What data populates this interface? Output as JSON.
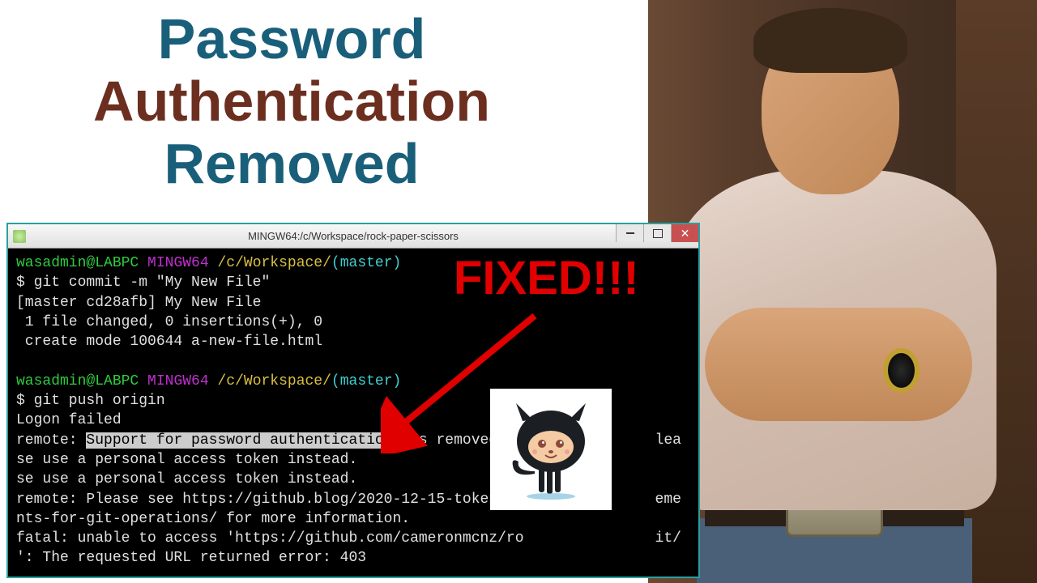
{
  "title": {
    "line1": "Password",
    "line2": "Authentication",
    "line3": "Removed"
  },
  "overlay": {
    "fixed": "FIXED!!!"
  },
  "window": {
    "title": "MINGW64:/c/Workspace/rock-paper-scissors"
  },
  "terminal": {
    "prompt1_user": "wasadmin@LABPC",
    "prompt1_env": "MINGW64",
    "prompt1_path": "/c/Workspace/",
    "prompt1_branch": "(master)",
    "cmd1": "$ git commit -m \"My New File\"",
    "out1a": "[master cd28afb] My New File",
    "out1b": " 1 file changed, 0 insertions(+), 0",
    "out1c": " create mode 100644 a-new-file.html",
    "prompt2_user": "wasadmin@LABPC",
    "prompt2_env": "MINGW64",
    "prompt2_path": "/c/Workspace/",
    "prompt2_branch": "(master)",
    "cmd2": "$ git push origin",
    "out2a": "Logon failed",
    "out2b_pre": "remote: ",
    "out2b_hl": "Support for password authentication",
    "out2b_post": " was removed on               lea",
    "out2c": "se use a personal access token instead.",
    "out2d": "se use a personal access token instead.",
    "out2e": "remote: Please see https://github.blog/2020-12-15-token-au               eme",
    "out2f": "nts-for-git-operations/ for more information.",
    "out2g": "fatal: unable to access 'https://github.com/cameronmcnz/ro               it/",
    "out2h": "': The requested URL returned error: 403"
  }
}
